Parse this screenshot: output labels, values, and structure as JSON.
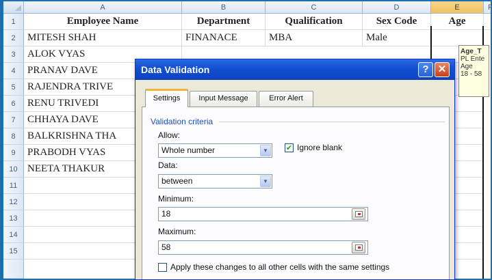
{
  "sheet": {
    "columns": [
      "A",
      "B",
      "C",
      "D",
      "E",
      "F"
    ],
    "rows": [
      "1",
      "2",
      "3",
      "4",
      "5",
      "6",
      "7",
      "8",
      "9",
      "10",
      "11",
      "12",
      "13",
      "14",
      "15"
    ],
    "headers": {
      "a": "Employee Name",
      "b": "Department",
      "c": "Qualification",
      "d": "Sex Code",
      "e": "Age"
    },
    "data": [
      {
        "a": "MITESH SHAH",
        "b": "FINANACE",
        "c": "MBA",
        "d": "Male"
      },
      {
        "a": "ALOK VYAS"
      },
      {
        "a": "PRANAV DAVE"
      },
      {
        "a": "RAJENDRA TRIVE"
      },
      {
        "a": "RENU TRIVEDI"
      },
      {
        "a": "CHHAYA DAVE"
      },
      {
        "a": "BALKRISHNA THA"
      },
      {
        "a": "PRABODH VYAS"
      },
      {
        "a": "NEETA THAKUR"
      }
    ],
    "selected_column": "E"
  },
  "input_message": {
    "title": "Age_T",
    "line1": "PL Ente",
    "line2": "Age",
    "line3": "18 - 58"
  },
  "dialog": {
    "title": "Data Validation",
    "help_glyph": "?",
    "close_glyph": "✕",
    "tabs": [
      "Settings",
      "Input Message",
      "Error Alert"
    ],
    "active_tab": "Settings",
    "group_title": "Validation criteria",
    "allow_label": "Allow:",
    "allow_value": "Whole number",
    "ignore_blank_label": "Ignore blank",
    "ignore_blank_checked": true,
    "data_label": "Data:",
    "data_value": "between",
    "minimum_label": "Minimum:",
    "minimum_value": "18",
    "maximum_label": "Maximum:",
    "maximum_value": "58",
    "apply_all_label": "Apply these changes to all other cells with the same settings",
    "apply_all_checked": false
  },
  "colors": {
    "frame": "#1e6fb0",
    "title_bar": "#1350d4",
    "selected_header": "#f1c15f"
  }
}
